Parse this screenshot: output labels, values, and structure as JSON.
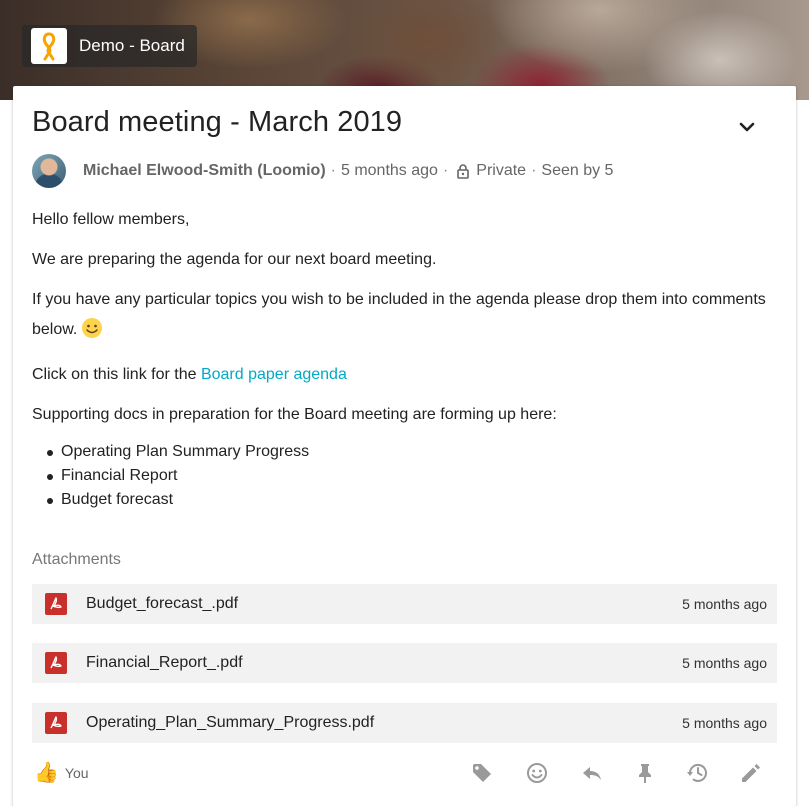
{
  "group": {
    "name": "Demo - Board"
  },
  "discussion": {
    "title": "Board meeting - March 2019",
    "author": "Michael Elwood-Smith (Loomio)",
    "time": "5 months ago",
    "privacy": "Private",
    "seen": "Seen by 5",
    "sep": "·"
  },
  "body": {
    "p1": "Hello fellow members,",
    "p2": "We are preparing the agenda for our next board meeting.",
    "p3": "If you have any particular topics you wish to be included in the agenda please drop them into comments below.",
    "p4_prefix": "Click on this link for the ",
    "p4_link": "Board paper agenda",
    "p5": "Supporting docs in preparation for the Board meeting are forming up here:",
    "bullets": [
      "Operating Plan Summary Progress",
      "Financial Report",
      "Budget forecast"
    ]
  },
  "attachments": {
    "heading": "Attachments",
    "items": [
      {
        "name": "Budget_forecast_.pdf",
        "time": "5 months ago"
      },
      {
        "name": "Financial_Report_.pdf",
        "time": "5 months ago"
      },
      {
        "name": "Operating_Plan_Summary_Progress.pdf",
        "time": "5 months ago"
      }
    ]
  },
  "reactions": {
    "thumb_emoji": "👍",
    "label": "You"
  },
  "icons": {
    "group_logo": "loomio-logo-icon",
    "chevron": "chevron-down-icon",
    "lock": "lock-icon",
    "smile": "smiley-emoji-icon",
    "pdf": "pdf-file-icon",
    "tag": "tag-icon",
    "react": "emoji-react-icon",
    "reply": "reply-icon",
    "pin": "pin-icon",
    "history": "history-icon",
    "edit": "edit-pencil-icon"
  },
  "colors": {
    "link": "#00aac7",
    "pdf_red": "#c9302c",
    "logo_orange": "#f7a400"
  }
}
